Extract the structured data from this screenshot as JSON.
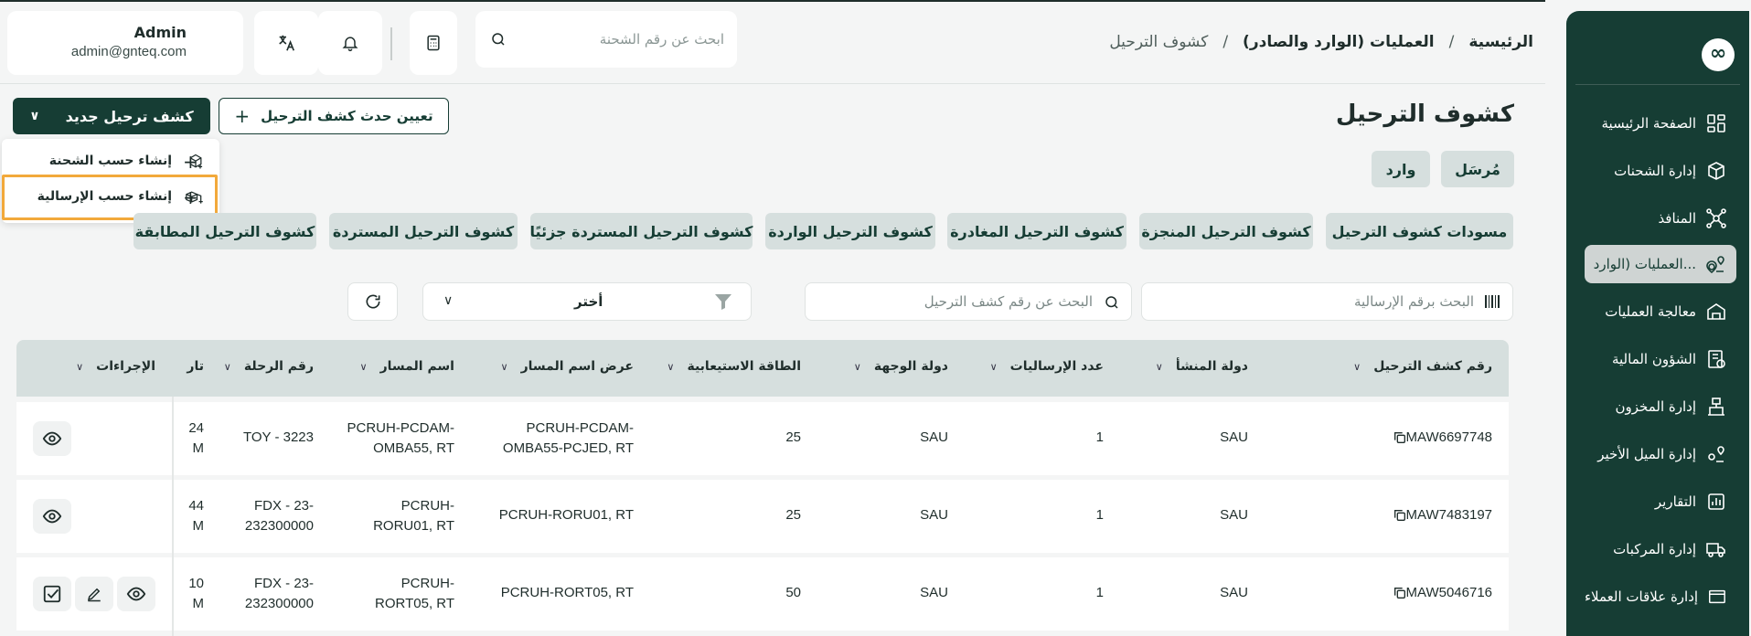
{
  "user": {
    "name": "Admin",
    "email": "admin@gnteq.com"
  },
  "icons": {
    "translate": "translate-icon",
    "bell": "bell-icon",
    "calculator": "calculator-icon",
    "search": "search-icon",
    "logo": "infinity-logo"
  },
  "top_search": {
    "placeholder": "ابحث عن رقم الشحنة"
  },
  "breadcrumb": {
    "home": "الرئيسية",
    "section": "العمليات (الوارد والصادر)",
    "current": "كشوف الترحيل",
    "sep": "/"
  },
  "page": {
    "title": "كشوف الترحيل"
  },
  "actions": {
    "new_manifest": "كشف ترحيل جديد",
    "assign_event": "تعيين حدث كشف الترحيل",
    "dropdown": {
      "by_shipment": "إنشاء حسب الشحنة",
      "by_consignment": "إنشاء حسب الإرسالية"
    }
  },
  "type_tabs": [
    "مُرسَل",
    "وارد"
  ],
  "status_tabs": [
    "مسودات كشوف الترحيل",
    "كشوف الترحيل المنجزة",
    "كشوف الترحيل المغادرة",
    "كشوف الترحيل الواردة",
    "كشوف الترحيل المستردة جزئيًا",
    "كشوف الترحيل المستردة",
    "كشوف الترحيل المطابقة"
  ],
  "filters": {
    "consignment_search": "البحث برقم الإرسالية",
    "manifest_search": "البحث عن رقم كشف الترحيل",
    "select_value": "أختر"
  },
  "table": {
    "headers": {
      "manifest_no": "رقم كشف الترحيل",
      "origin": "دولة المنشأ",
      "count": "عدد الإرساليات",
      "dest": "دولة الوجهة",
      "capacity": "الطاقة الاستيعابية",
      "route_display": "عرض اسم المسار",
      "route_name": "اسم المسار",
      "flight": "رقم الرحلة",
      "date": "تار",
      "actions": "الإجراءات"
    },
    "rows": [
      {
        "manifest_no": "MAW6697748",
        "origin": "SAU",
        "count": "1",
        "dest": "SAU",
        "capacity": "25",
        "route_display_1": "PCRUH-PCDAM-",
        "route_display_2": "OMBA55-PCJED, RT",
        "route_name_1": "PCRUH-PCDAM-",
        "route_name_2": "OMBA55, RT",
        "flight_1": "TOY - 3223",
        "flight_2": "",
        "date_1": "24",
        "date_2": "M"
      },
      {
        "manifest_no": "MAW7483197",
        "origin": "SAU",
        "count": "1",
        "dest": "SAU",
        "capacity": "25",
        "route_display_1": "PCRUH-RORU01, RT",
        "route_display_2": "",
        "route_name_1": "PCRUH-",
        "route_name_2": "RORU01, RT",
        "flight_1": "FDX - 23-",
        "flight_2": "232300000",
        "date_1": "44",
        "date_2": "M"
      },
      {
        "manifest_no": "MAW5046716",
        "origin": "SAU",
        "count": "1",
        "dest": "SAU",
        "capacity": "50",
        "route_display_1": "PCRUH-RORT05, RT",
        "route_display_2": "",
        "route_name_1": "PCRUH-",
        "route_name_2": "RORT05, RT",
        "flight_1": "FDX - 23-",
        "flight_2": "232300000",
        "date_1": "10",
        "date_2": "M"
      }
    ]
  },
  "sidebar": {
    "items": [
      {
        "label": "الصفحة الرئيسية",
        "icon": "dashboard-icon"
      },
      {
        "label": "إدارة الشحنات",
        "icon": "package-icon"
      },
      {
        "label": "المنافذ",
        "icon": "network-icon"
      },
      {
        "label": "العمليات (الوارد...",
        "icon": "route-icon",
        "active": true
      },
      {
        "label": "معالجة العمليات",
        "icon": "warehouse-icon"
      },
      {
        "label": "الشؤون المالية",
        "icon": "finance-icon"
      },
      {
        "label": "إدارة المخزون",
        "icon": "inventory-icon"
      },
      {
        "label": "إدارة الميل الأخير",
        "icon": "last-mile-icon"
      },
      {
        "label": "التقارير",
        "icon": "reports-icon"
      },
      {
        "label": "إدارة المركبات",
        "icon": "truck-icon"
      },
      {
        "label": "إدارة علاقات العملاء",
        "icon": "crm-icon"
      }
    ]
  },
  "colors": {
    "primary": "#163d34",
    "tab_bg": "#d6dfde",
    "highlight": "#f2a93b",
    "page_bg": "#f4f5f5"
  }
}
